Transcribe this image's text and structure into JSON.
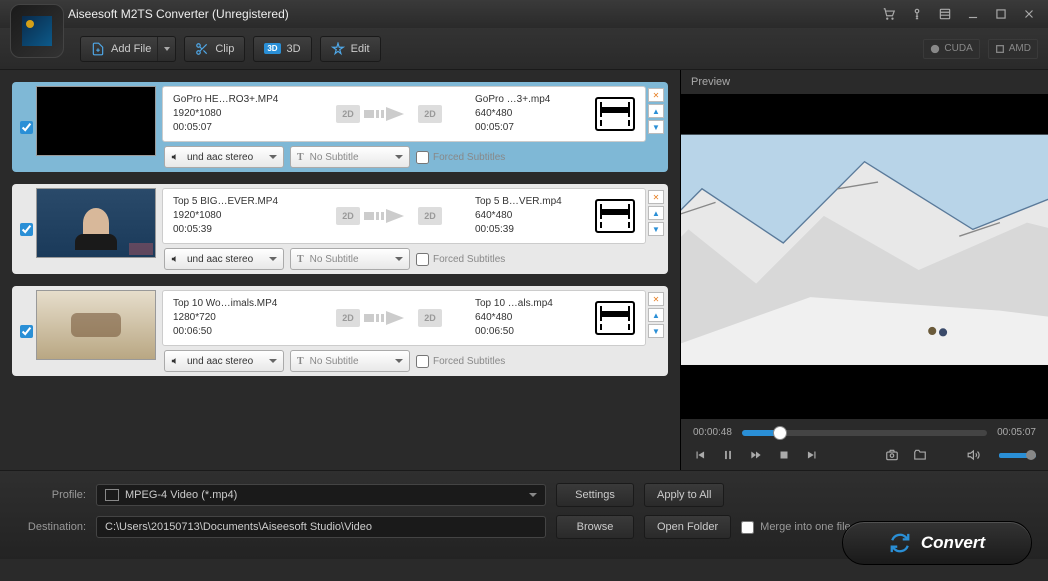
{
  "app": {
    "title": "Aiseesoft M2TS Converter (Unregistered)"
  },
  "toolbar": {
    "add_file": "Add File",
    "clip": "Clip",
    "three_d": "3D",
    "edit": "Edit",
    "cuda": "CUDA",
    "amd": "AMD"
  },
  "files": [
    {
      "selected": true,
      "src_name": "GoPro HE…RO3+.MP4",
      "src_res": "1920*1080",
      "src_dur": "00:05:07",
      "out_name": "GoPro …3+.mp4",
      "out_res": "640*480",
      "out_dur": "00:05:07",
      "audio": "und aac stereo",
      "subtitle": "No Subtitle",
      "forced": "Forced Subtitles"
    },
    {
      "selected": false,
      "src_name": "Top 5 BIG…EVER.MP4",
      "src_res": "1920*1080",
      "src_dur": "00:05:39",
      "out_name": "Top 5 B…VER.mp4",
      "out_res": "640*480",
      "out_dur": "00:05:39",
      "audio": "und aac stereo",
      "subtitle": "No Subtitle",
      "forced": "Forced Subtitles"
    },
    {
      "selected": false,
      "src_name": "Top 10 Wo…imals.MP4",
      "src_res": "1280*720",
      "src_dur": "00:06:50",
      "out_name": "Top 10 …als.mp4",
      "out_res": "640*480",
      "out_dur": "00:06:50",
      "audio": "und aac stereo",
      "subtitle": "No Subtitle",
      "forced": "Forced Subtitles"
    }
  ],
  "preview": {
    "label": "Preview",
    "time_current": "00:00:48",
    "time_total": "00:05:07",
    "progress_pct": 15.6
  },
  "footer": {
    "profile_label": "Profile:",
    "profile_value": "MPEG-4 Video (*.mp4)",
    "settings": "Settings",
    "apply_all": "Apply to All",
    "dest_label": "Destination:",
    "dest_value": "C:\\Users\\20150713\\Documents\\Aiseesoft Studio\\Video",
    "browse": "Browse",
    "open_folder": "Open Folder",
    "merge": "Merge into one file",
    "convert": "Convert"
  }
}
